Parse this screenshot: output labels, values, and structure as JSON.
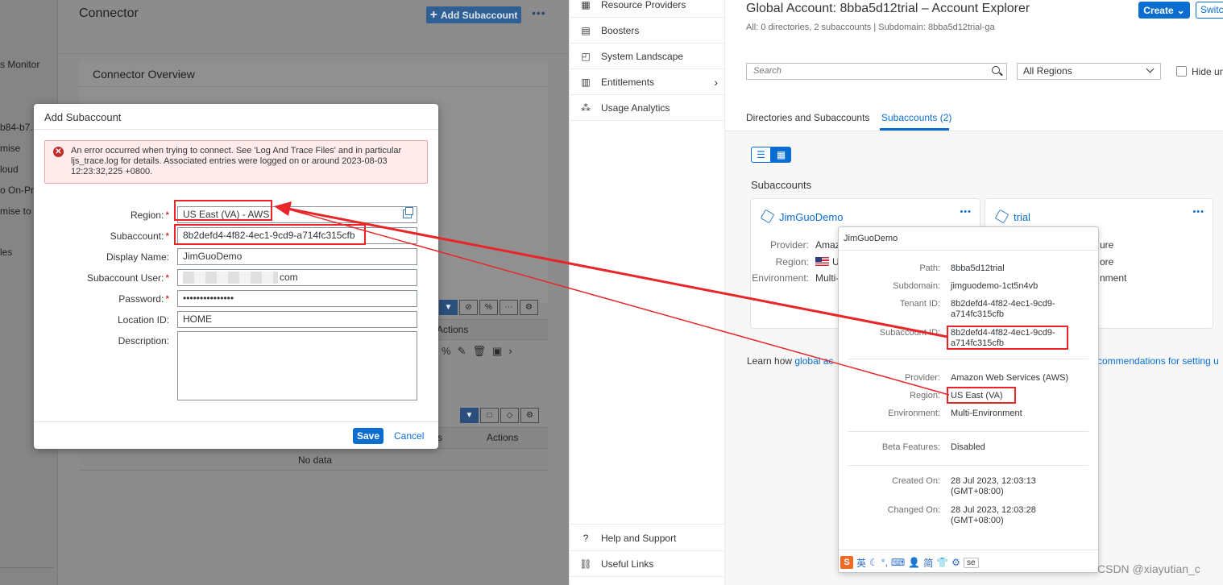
{
  "left_panel": {
    "nav_items": [
      "s Monitor",
      "b84-b7...",
      "mise",
      "loud",
      "o On-Pre",
      "mise to C",
      "les"
    ],
    "page_title": "Connector",
    "add_subaccount_label": "Add Subaccount",
    "more_label": "•••",
    "overview_title": "Connector Overview",
    "table1_actions_label": "Actions",
    "table2_col_s": "s",
    "table2_actions_label": "Actions",
    "no_data": "No data"
  },
  "dialog": {
    "title": "Add Subaccount",
    "error_icon": "error-icon",
    "error_text": "An error occurred when trying to connect. See 'Log And Trace Files' and in particular ljs_trace.log for details. Associated entries were logged on or around 2023-08-03 12:23:32,225 +0800.",
    "fields": {
      "region": {
        "label": "Region:",
        "value": "US East (VA) - AWS",
        "required": "*"
      },
      "subaccount": {
        "label": "Subaccount:",
        "value": "8b2defd4-4f82-4ec1-9cd9-a714fc315cfb",
        "required": "*"
      },
      "display_name": {
        "label": "Display Name:",
        "value": "JimGuoDemo"
      },
      "subaccount_user": {
        "label": "Subaccount User:",
        "value": "com",
        "required": "*"
      },
      "password": {
        "label": "Password:",
        "value": "•••••••••••••••",
        "required": "*"
      },
      "location_id": {
        "label": "Location ID:",
        "value": "HOME"
      },
      "description": {
        "label": "Description:",
        "value": ""
      }
    },
    "save_label": "Save",
    "cancel_label": "Cancel"
  },
  "middle_nav": {
    "items": [
      {
        "label": "Resource Providers",
        "icon": "resource-providers-icon"
      },
      {
        "label": "Boosters",
        "icon": "boosters-icon"
      },
      {
        "label": "System Landscape",
        "icon": "system-landscape-icon"
      },
      {
        "label": "Entitlements",
        "icon": "entitlements-icon"
      },
      {
        "label": "Usage Analytics",
        "icon": "usage-analytics-icon"
      }
    ],
    "bottom_items": [
      {
        "label": "Help and Support",
        "icon": "help-icon"
      },
      {
        "label": "Useful Links",
        "icon": "link-icon"
      }
    ]
  },
  "explorer": {
    "title": "Global Account: 8bba5d12trial – Account Explorer",
    "subtitle": "All: 0 directories, 2 subaccounts | Subdomain: 8bba5d12trial-ga",
    "create_label": "Create",
    "switch_label": "Switch",
    "search_placeholder": "Search",
    "regions_value": "All Regions",
    "hide_label": "Hide un",
    "tabs": [
      "Directories and Subaccounts",
      "Subaccounts (2)"
    ],
    "section_title": "Subaccounts",
    "card1": {
      "name": "JimGuoDemo",
      "provider_label": "Provider:",
      "provider_value": "Amaz",
      "region_label": "Region:",
      "region_value": "U",
      "environment_label": "Environment:",
      "environment_value": "Multi-"
    },
    "card2": {
      "name": "trial",
      "v1": "ure",
      "v2": "ore",
      "v3": "nment"
    },
    "learn_prefix": "Learn how ",
    "learn_link": "global ac",
    "learn_suffix_link": "commendations for setting u"
  },
  "popover": {
    "title": "JimGuoDemo",
    "rows": [
      {
        "label": "Path:",
        "value": "8bba5d12trial"
      },
      {
        "label": "Subdomain:",
        "value": "jimguodemo-1ct5n4vb"
      },
      {
        "label": "Tenant ID:",
        "value": "8b2defd4-4f82-4ec1-9cd9-a714fc315cfb"
      },
      {
        "label": "Subaccount ID:",
        "value": "8b2defd4-4f82-4ec1-9cd9-a714fc315cfb"
      },
      {
        "label": "Provider:",
        "value": "Amazon Web Services (AWS)"
      },
      {
        "label": "Region:",
        "value": "US East (VA)"
      },
      {
        "label": "Environment:",
        "value": "Multi-Environment"
      },
      {
        "label": "Beta Features:",
        "value": "Disabled"
      },
      {
        "label": "Created On:",
        "value": "28 Jul 2023, 12:03:13 (GMT+08:00)"
      },
      {
        "label": "Changed On:",
        "value": "28 Jul 2023, 12:03:28 (GMT+08:00)"
      }
    ],
    "ime": {
      "logo": "S",
      "lang": "英",
      "box_text": "se"
    }
  },
  "watermark": "CSDN @xiayutian_c",
  "colors": {
    "accent": "#0a6ed1",
    "error": "#bb0000",
    "annotation": "#e8262a"
  }
}
